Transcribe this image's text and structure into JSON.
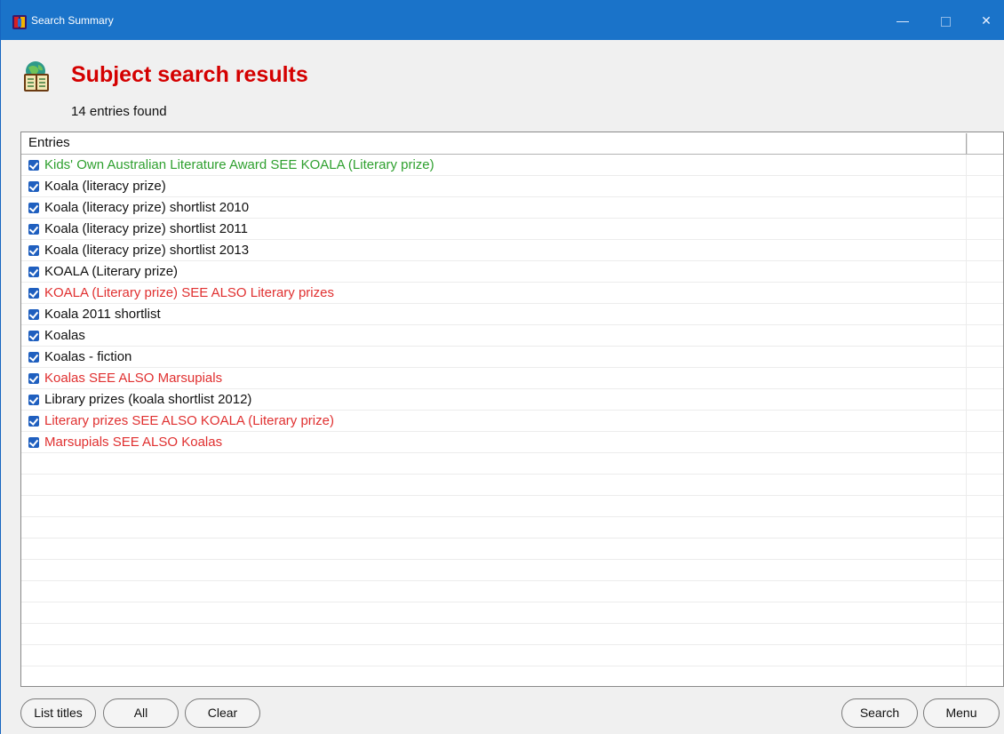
{
  "window": {
    "title": "Search Summary",
    "controls": {
      "minimize": "—",
      "close": "✕"
    }
  },
  "header": {
    "title": "Subject search results",
    "count_text": "14 entries found"
  },
  "list": {
    "column_header": "Entries",
    "rows": [
      {
        "text": "Kids' Own Australian Literature Award SEE KOALA (Literary prize)",
        "color": "#2fa02f",
        "checked": true
      },
      {
        "text": "Koala (literacy prize)",
        "color": "#111111",
        "checked": true
      },
      {
        "text": "Koala (literacy prize) shortlist 2010",
        "color": "#111111",
        "checked": true
      },
      {
        "text": "Koala (literacy prize) shortlist 2011",
        "color": "#111111",
        "checked": true
      },
      {
        "text": "Koala (literacy prize) shortlist 2013",
        "color": "#111111",
        "checked": true
      },
      {
        "text": "KOALA (Literary prize)",
        "color": "#111111",
        "checked": true
      },
      {
        "text": "KOALA (Literary prize) SEE ALSO Literary prizes",
        "color": "#e03030",
        "checked": true
      },
      {
        "text": "Koala 2011 shortlist",
        "color": "#111111",
        "checked": true
      },
      {
        "text": "Koalas",
        "color": "#111111",
        "checked": true
      },
      {
        "text": "Koalas - fiction",
        "color": "#111111",
        "checked": true
      },
      {
        "text": "Koalas SEE ALSO Marsupials",
        "color": "#e03030",
        "checked": true
      },
      {
        "text": "Library prizes (koala shortlist 2012)",
        "color": "#111111",
        "checked": true
      },
      {
        "text": "Literary prizes SEE ALSO KOALA (Literary prize)",
        "color": "#e03030",
        "checked": true
      },
      {
        "text": "Marsupials SEE ALSO Koalas",
        "color": "#e03030",
        "checked": true
      }
    ],
    "empty_rows": 11
  },
  "buttons": {
    "list_titles": "List titles",
    "all": "All",
    "clear": "Clear",
    "search": "Search",
    "menu": "Menu"
  },
  "colors": {
    "titlebar": "#1a73c9",
    "heading": "#d40000",
    "see_reference": "#2fa02f",
    "see_also_reference": "#e03030",
    "checkbox": "#1f5fbf"
  },
  "icons": {
    "app": "app-icon",
    "heading": "books-globe-icon"
  }
}
